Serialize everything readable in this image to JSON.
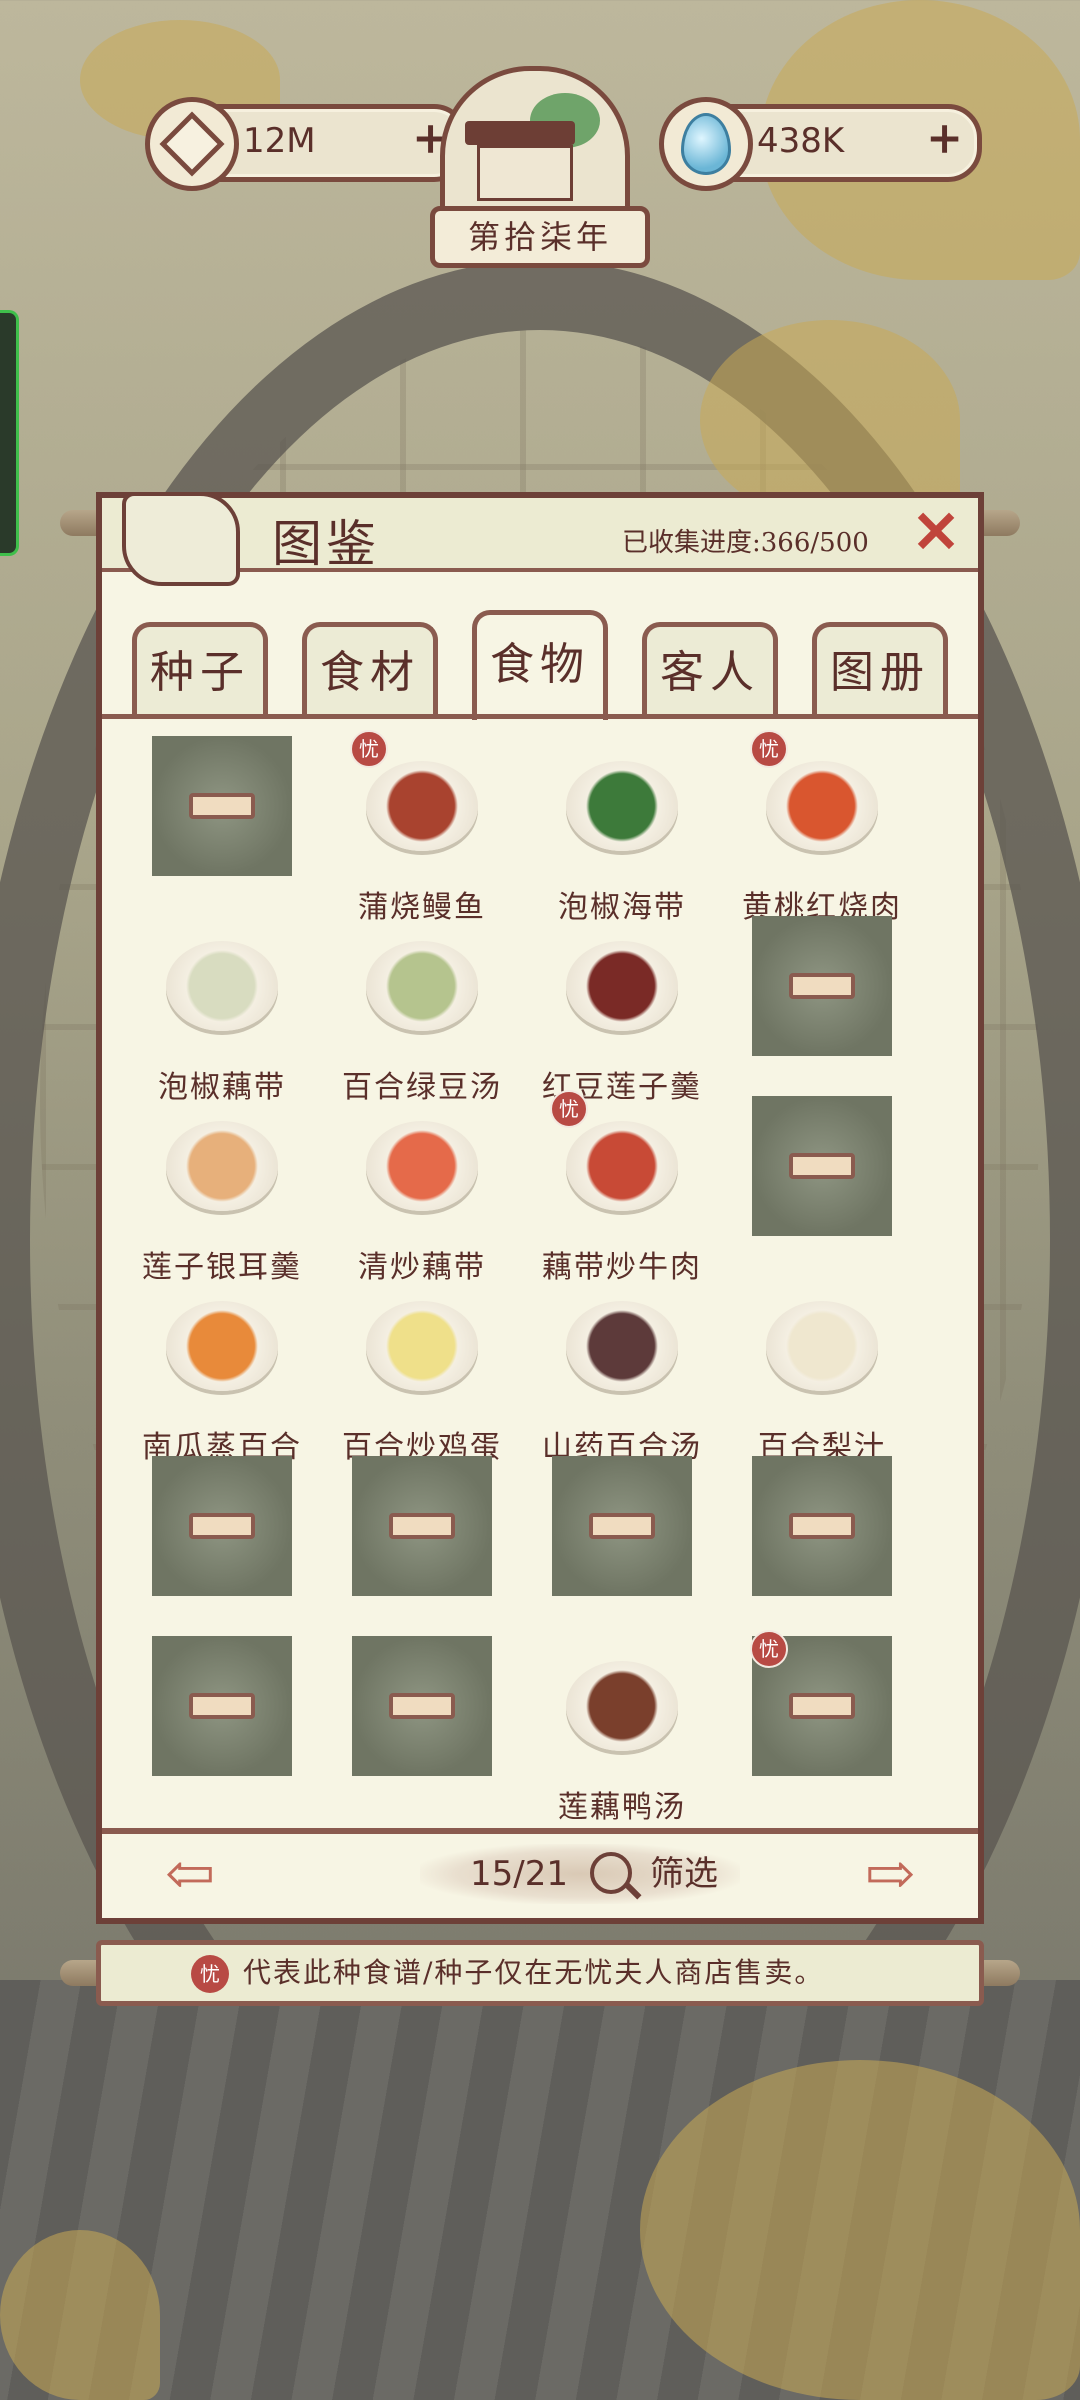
{
  "resources": {
    "coins": "12M",
    "water": "438K",
    "coin_icon": "coin-icon",
    "water_icon": "water-drop-icon"
  },
  "year_label": "第拾柒年",
  "panel": {
    "title": "图鉴",
    "progress": "已收集进度:366/500",
    "close_icon": "close-icon"
  },
  "tabs": [
    "种子",
    "食材",
    "食物",
    "客人",
    "图册"
  ],
  "active_tab": "食物",
  "items": [
    {
      "name": "",
      "locked": true,
      "exclusive": false
    },
    {
      "name": "蒲烧鳗鱼",
      "locked": false,
      "exclusive": true,
      "color": "#a9432f"
    },
    {
      "name": "泡椒海带",
      "locked": false,
      "exclusive": false,
      "color": "#3d7a3a"
    },
    {
      "name": "黄桃红烧肉",
      "locked": false,
      "exclusive": true,
      "color": "#d9562f"
    },
    {
      "name": "泡椒藕带",
      "locked": false,
      "exclusive": false,
      "color": "#d8dcc0"
    },
    {
      "name": "百合绿豆汤",
      "locked": false,
      "exclusive": false,
      "color": "#b5c48e"
    },
    {
      "name": "红豆莲子羹",
      "locked": false,
      "exclusive": false,
      "color": "#7a2a26"
    },
    {
      "name": "",
      "locked": true,
      "exclusive": false
    },
    {
      "name": "莲子银耳羹",
      "locked": false,
      "exclusive": false,
      "color": "#e7b07b"
    },
    {
      "name": "清炒藕带",
      "locked": false,
      "exclusive": false,
      "color": "#e56a4a"
    },
    {
      "name": "藕带炒牛肉",
      "locked": false,
      "exclusive": true,
      "color": "#c84a36"
    },
    {
      "name": "",
      "locked": true,
      "exclusive": false
    },
    {
      "name": "南瓜蒸百合",
      "locked": false,
      "exclusive": false,
      "color": "#e88a3a"
    },
    {
      "name": "百合炒鸡蛋",
      "locked": false,
      "exclusive": false,
      "color": "#efe08a"
    },
    {
      "name": "山药百合汤",
      "locked": false,
      "exclusive": false,
      "color": "#5d3a3a"
    },
    {
      "name": "百合梨汁",
      "locked": false,
      "exclusive": false,
      "color": "#efe7cf"
    },
    {
      "name": "",
      "locked": true,
      "exclusive": false
    },
    {
      "name": "",
      "locked": true,
      "exclusive": false
    },
    {
      "name": "",
      "locked": true,
      "exclusive": false
    },
    {
      "name": "",
      "locked": true,
      "exclusive": false
    },
    {
      "name": "",
      "locked": true,
      "exclusive": false
    },
    {
      "name": "",
      "locked": true,
      "exclusive": false
    },
    {
      "name": "莲藕鸭汤",
      "locked": false,
      "exclusive": false,
      "color": "#7a3f2c"
    },
    {
      "name": "",
      "locked": true,
      "exclusive": true
    }
  ],
  "pager": {
    "page": "15/21",
    "filter_label": "筛选",
    "prev_icon": "arrow-left-icon",
    "next_icon": "arrow-right-icon"
  },
  "badge_glyph": "忧",
  "notice": "代表此种食谱/种子仅在无忧夫人商店售卖。"
}
